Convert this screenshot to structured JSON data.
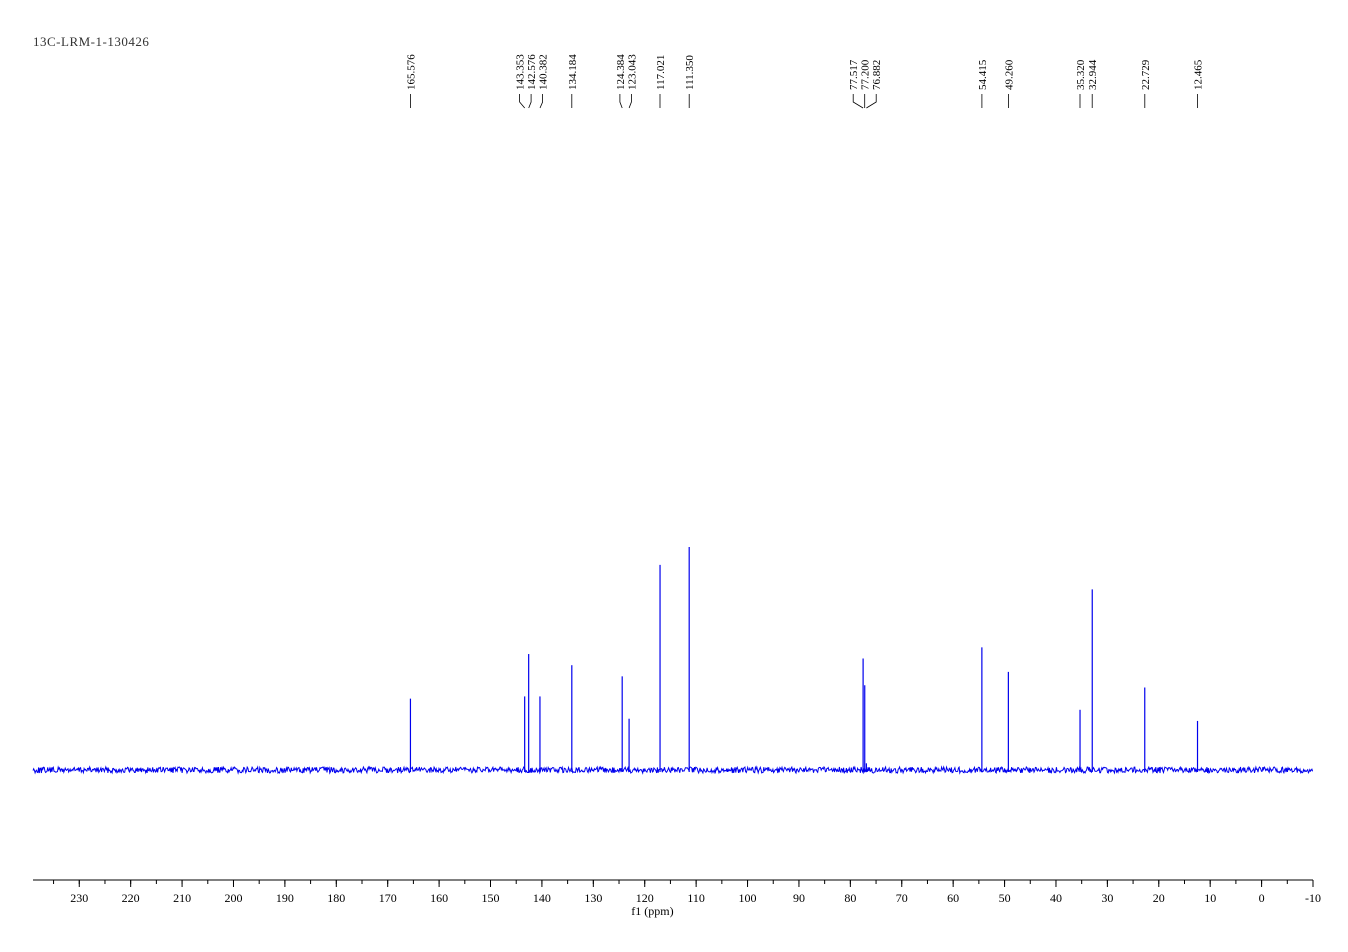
{
  "chart_data": {
    "type": "line",
    "title": "13C-LRM-1-130426",
    "xlabel": "f1 (ppm)",
    "ylabel": "",
    "xlim": [
      239,
      -10
    ],
    "x_reversed": true,
    "grid": false,
    "line_color": "#0000ee",
    "tick_values": [
      230,
      220,
      210,
      200,
      190,
      180,
      170,
      160,
      150,
      140,
      130,
      120,
      110,
      100,
      90,
      80,
      70,
      60,
      50,
      40,
      30,
      20,
      10,
      0,
      -10
    ],
    "peak_labels": [
      "165.576",
      "143.353",
      "142.576",
      "140.382",
      "134.184",
      "124.384",
      "123.043",
      "117.021",
      "111.350",
      "77.517",
      "77.200",
      "76.882",
      "54.415",
      "49.260",
      "35.320",
      "32.944",
      "22.729",
      "12.465"
    ],
    "peaks": [
      {
        "ppm": 165.576,
        "intensity": 0.32
      },
      {
        "ppm": 143.353,
        "intensity": 0.33
      },
      {
        "ppm": 142.576,
        "intensity": 0.52
      },
      {
        "ppm": 140.382,
        "intensity": 0.33
      },
      {
        "ppm": 134.184,
        "intensity": 0.47
      },
      {
        "ppm": 124.384,
        "intensity": 0.42
      },
      {
        "ppm": 123.043,
        "intensity": 0.23
      },
      {
        "ppm": 117.021,
        "intensity": 0.92
      },
      {
        "ppm": 111.35,
        "intensity": 1.0
      },
      {
        "ppm": 77.517,
        "intensity": 0.5
      },
      {
        "ppm": 77.2,
        "intensity": 0.38
      },
      {
        "ppm": 76.882,
        "intensity": 0.03
      },
      {
        "ppm": 54.415,
        "intensity": 0.55
      },
      {
        "ppm": 49.26,
        "intensity": 0.44
      },
      {
        "ppm": 35.32,
        "intensity": 0.27
      },
      {
        "ppm": 32.944,
        "intensity": 0.81
      },
      {
        "ppm": 22.729,
        "intensity": 0.37
      },
      {
        "ppm": 12.465,
        "intensity": 0.22
      }
    ]
  }
}
